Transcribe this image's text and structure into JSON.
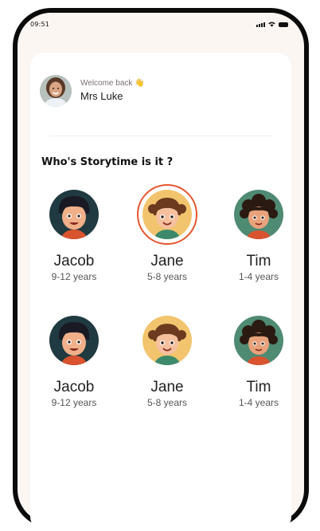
{
  "status_bar": {
    "time": "09:51"
  },
  "profile": {
    "welcome_text": "Welcome back",
    "name": "Mrs Luke"
  },
  "section_title": "Who's Storytime is it ?",
  "children": [
    {
      "name": "Jacob",
      "age": "9-12 years",
      "avatar": "boy-dark-hair",
      "selected": false
    },
    {
      "name": "Jane",
      "age": "5-8 years",
      "avatar": "girl-pigtails",
      "selected": true
    },
    {
      "name": "Tim",
      "age": "1-4 years",
      "avatar": "boy-curly-hair",
      "selected": false
    },
    {
      "name": "Jacob",
      "age": "9-12 years",
      "avatar": "boy-dark-hair",
      "selected": false
    },
    {
      "name": "Jane",
      "age": "5-8 years",
      "avatar": "girl-pigtails",
      "selected": false
    },
    {
      "name": "Tim",
      "age": "1-4 years",
      "avatar": "boy-curly-hair",
      "selected": false
    }
  ],
  "colors": {
    "accent": "#e5572f",
    "background": "#fcf6f3",
    "frame": "#0b0b0b"
  }
}
